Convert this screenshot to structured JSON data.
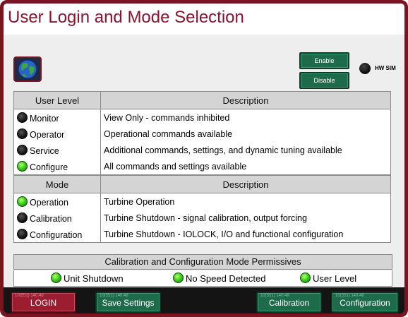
{
  "title": "User Login and Mode Selection",
  "hw": {
    "enable_label": "Enable",
    "disable_label": "Disable",
    "sim_label": "HW SIM",
    "sim_state": "off"
  },
  "user_table": {
    "headers": [
      "User Level",
      "Description"
    ],
    "rows": [
      {
        "label": "Monitor",
        "description": "View Only - commands inhibited",
        "state": "off"
      },
      {
        "label": "Operator",
        "description": "Operational commands available",
        "state": "off"
      },
      {
        "label": "Service",
        "description": "Additional commands, settings, and dynamic tuning available",
        "state": "off"
      },
      {
        "label": "Configure",
        "description": "All commands and settings available",
        "state": "on"
      }
    ]
  },
  "mode_table": {
    "headers": [
      "Mode",
      "Description"
    ],
    "rows": [
      {
        "label": "Operation",
        "description": "Turbine Operation",
        "state": "on"
      },
      {
        "label": "Calibration",
        "description": "Turbine Shutdown - signal calibration, output forcing",
        "state": "off"
      },
      {
        "label": "Configuration",
        "description": "Turbine Shutdown - IOLOCK, I/O and functional configuration",
        "state": "off"
      }
    ]
  },
  "permissives": {
    "title": "Calibration and Configuration Mode Permissives",
    "items": [
      {
        "label": "Unit Shutdown",
        "state": "on"
      },
      {
        "label": "No Speed Detected",
        "state": "on"
      },
      {
        "label": "User Level",
        "state": "on"
      }
    ]
  },
  "bottom": {
    "login": {
      "label": "LOGIN",
      "tag": "10(551) 140:48"
    },
    "save": {
      "label": "Save Settings",
      "tag": "10(551) 140:48"
    },
    "calibration": {
      "label": "Calibration",
      "tag": "10(551) 140:48"
    },
    "configuration": {
      "label": "Configuration",
      "tag": "10(551) 140:48"
    }
  },
  "colors": {
    "frame": "#7a1420",
    "title": "#8e1230",
    "button_green": "#1d6b4b",
    "button_red": "#9c1c30",
    "led_on": "#3ed11b"
  }
}
